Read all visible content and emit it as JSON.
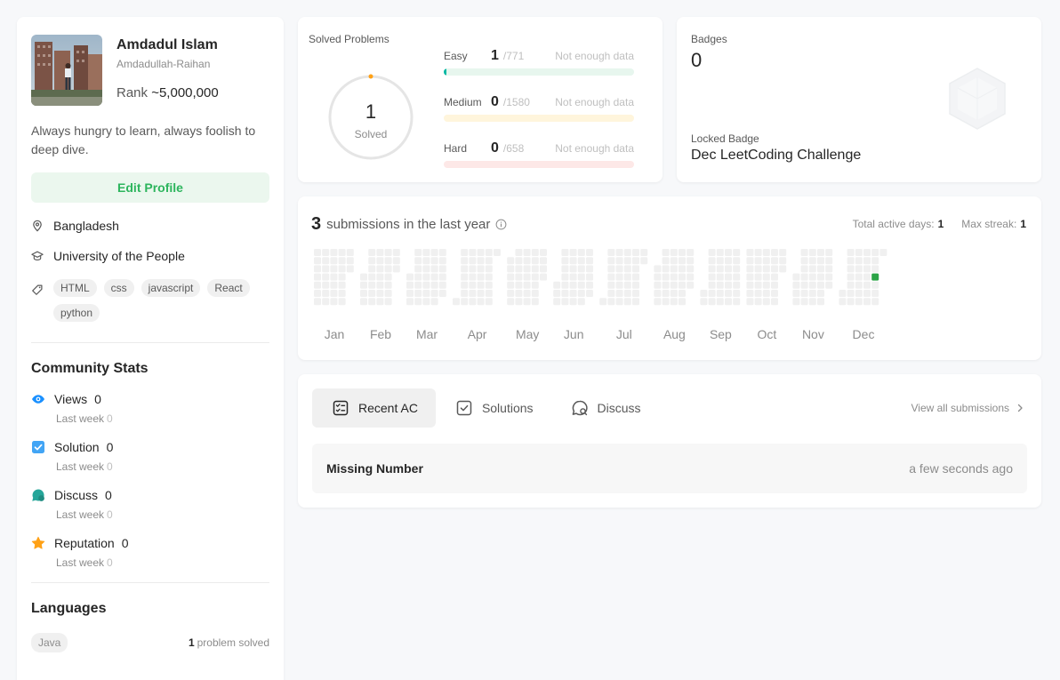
{
  "profile": {
    "name": "Amdadul Islam",
    "username": "Amdadullah-Raihan",
    "rank_label": "Rank",
    "rank_value": "~5,000,000",
    "bio": "Always hungry to learn, always foolish to deep dive.",
    "edit_label": "Edit Profile",
    "location": "Bangladesh",
    "school": "University of the People",
    "skills": [
      "HTML",
      "css",
      "javascript",
      "React",
      "python"
    ]
  },
  "community": {
    "title": "Community Stats",
    "last_week_label": "Last week",
    "items": [
      {
        "label": "Views",
        "value": "0",
        "last_week": "0",
        "icon": "eye-icon",
        "color": "#1a90ff"
      },
      {
        "label": "Solution",
        "value": "0",
        "last_week": "0",
        "icon": "check-square-icon",
        "color": "#42a5f5"
      },
      {
        "label": "Discuss",
        "value": "0",
        "last_week": "0",
        "icon": "chat-bubble-icon",
        "color": "#26a69a"
      },
      {
        "label": "Reputation",
        "value": "0",
        "last_week": "0",
        "icon": "star-icon",
        "color": "#ffa116"
      }
    ]
  },
  "languages": {
    "title": "Languages",
    "items": [
      {
        "name": "Java",
        "count": "1",
        "suffix": "problem solved"
      }
    ]
  },
  "solved": {
    "title": "Solved Problems",
    "total": "1",
    "total_label": "Solved",
    "difficulties": [
      {
        "name": "Easy",
        "solved": 1,
        "total": "/771",
        "note": "Not enough data",
        "color": "#00b8a3",
        "track": "#e7f6ee"
      },
      {
        "name": "Medium",
        "solved": 0,
        "total": "/1580",
        "note": "Not enough data",
        "color": "#ffc01e",
        "track": "#fff5dc"
      },
      {
        "name": "Hard",
        "solved": 0,
        "total": "/658",
        "note": "Not enough data",
        "color": "#ef4743",
        "track": "#fde8e7"
      }
    ]
  },
  "badges": {
    "label": "Badges",
    "count": "0",
    "locked_label": "Locked Badge",
    "locked_name": "Dec LeetCoding Challenge"
  },
  "submissions": {
    "count": "3",
    "text": "submissions in the last year",
    "active_days_label": "Total active days:",
    "active_days": "1",
    "max_streak_label": "Max streak:",
    "max_streak": "1",
    "months": [
      "Jan",
      "Feb",
      "Mar",
      "Apr",
      "May",
      "Jun",
      "Jul",
      "Aug",
      "Sep",
      "Oct",
      "Nov",
      "Dec"
    ],
    "active_color": "#2ca447",
    "empty_color": "#f0f0f0"
  },
  "recent": {
    "tabs": [
      {
        "label": "Recent AC",
        "icon": "list-check-icon"
      },
      {
        "label": "Solutions",
        "icon": "checkbox-icon"
      },
      {
        "label": "Discuss",
        "icon": "discuss-icon"
      }
    ],
    "view_all": "View all submissions",
    "items": [
      {
        "title": "Missing Number",
        "time": "a few seconds ago"
      }
    ]
  }
}
